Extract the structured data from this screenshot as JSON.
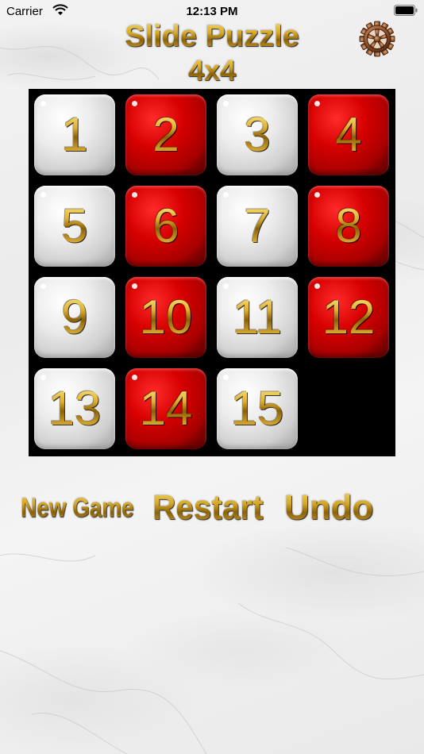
{
  "status_bar": {
    "carrier": "Carrier",
    "time": "12:13 PM"
  },
  "header": {
    "title": "Slide Puzzle",
    "subtitle": "4x4",
    "settings_icon": "gear-icon"
  },
  "board": {
    "size": 4,
    "empty_cell": 16,
    "tiles": [
      {
        "label": "1",
        "style": "white"
      },
      {
        "label": "2",
        "style": "red"
      },
      {
        "label": "3",
        "style": "white"
      },
      {
        "label": "4",
        "style": "red"
      },
      {
        "label": "5",
        "style": "white"
      },
      {
        "label": "6",
        "style": "red"
      },
      {
        "label": "7",
        "style": "white"
      },
      {
        "label": "8",
        "style": "red"
      },
      {
        "label": "9",
        "style": "white"
      },
      {
        "label": "10",
        "style": "red"
      },
      {
        "label": "11",
        "style": "white"
      },
      {
        "label": "12",
        "style": "red"
      },
      {
        "label": "13",
        "style": "white"
      },
      {
        "label": "14",
        "style": "red"
      },
      {
        "label": "15",
        "style": "white"
      }
    ]
  },
  "controls": {
    "new_game": "New Game",
    "restart": "Restart",
    "undo": "Undo"
  },
  "colors": {
    "board_bg": "#000000",
    "tile_red": "#d60000",
    "tile_white": "#ececec",
    "gold": "#c69326"
  }
}
